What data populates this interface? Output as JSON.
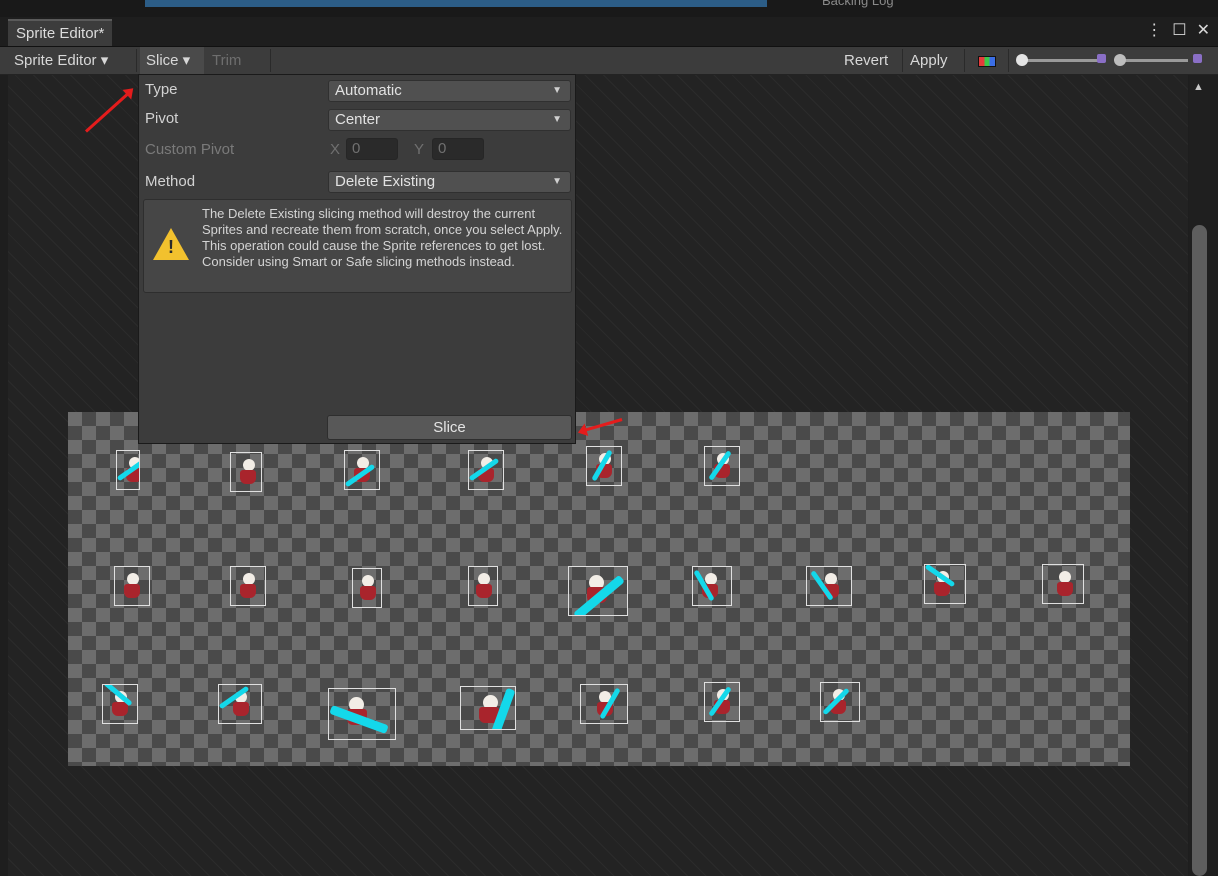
{
  "top_strip": {
    "baking_tab": "Backing Log"
  },
  "window": {
    "tab_title": "Sprite Editor*",
    "menu_glyph": "⋮",
    "maximize_glyph": "☐",
    "close_glyph": "✕"
  },
  "toolbar": {
    "mode_dropdown": "Sprite Editor ▾",
    "slice_label": "Slice ▾",
    "trim_label": "Trim",
    "revert_label": "Revert",
    "apply_label": "Apply"
  },
  "slice_panel": {
    "type": {
      "label": "Type",
      "value": "Automatic"
    },
    "pivot": {
      "label": "Pivot",
      "value": "Center"
    },
    "custom_pivot": {
      "label": "Custom Pivot",
      "x_label": "X",
      "x_value": "0",
      "y_label": "Y",
      "y_value": "0"
    },
    "method": {
      "label": "Method",
      "value": "Delete Existing"
    },
    "warning_text": "The Delete Existing slicing method will destroy the current Sprites and recreate them from scratch, once you select Apply. This operation could cause the Sprite references to get lost. Consider using Smart or Safe slicing methods instead.",
    "slice_button": "Slice"
  },
  "sprite_sheet": {
    "rows": [
      6,
      9,
      7
    ]
  },
  "colors": {
    "annotation_arrow": "#e41c1c",
    "slash_fx": "#14d8ea",
    "character_body": "#a9242c",
    "warning": "#f2c12e"
  }
}
